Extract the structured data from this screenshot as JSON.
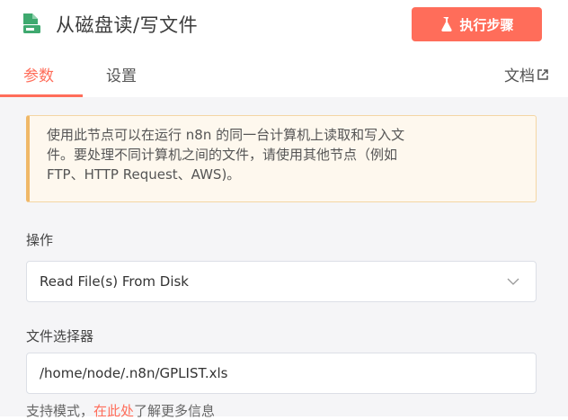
{
  "header": {
    "title": "从磁盘读/写文件",
    "icon": "file-disk-icon",
    "execute_label": "执行步骤",
    "execute_icon": "flask-icon"
  },
  "tabs": [
    {
      "label": "参数",
      "active": true
    },
    {
      "label": "设置",
      "active": false
    }
  ],
  "docs_link": {
    "label": "文档",
    "icon": "external-link-icon"
  },
  "notice": {
    "lines": [
      "使用此节点可以在运行 n8n 的同一台计算机上读取和写入文",
      "件。要处理不同计算机之间的文件，请使用其他节点（例如",
      "FTP、HTTP Request、AWS)。"
    ]
  },
  "operation": {
    "label": "操作",
    "value": "Read File(s) From Disk"
  },
  "file_selector": {
    "label": "文件选择器",
    "value": "/home/node/.n8n/GPLIST.xls"
  },
  "hint": {
    "prefix": "支持模式，",
    "link": "在此处",
    "suffix": "了解更多信息"
  },
  "colors": {
    "accent": "#ff6d5a",
    "node_icon": "#3fa96f",
    "notice_bg": "#fef8ee"
  }
}
